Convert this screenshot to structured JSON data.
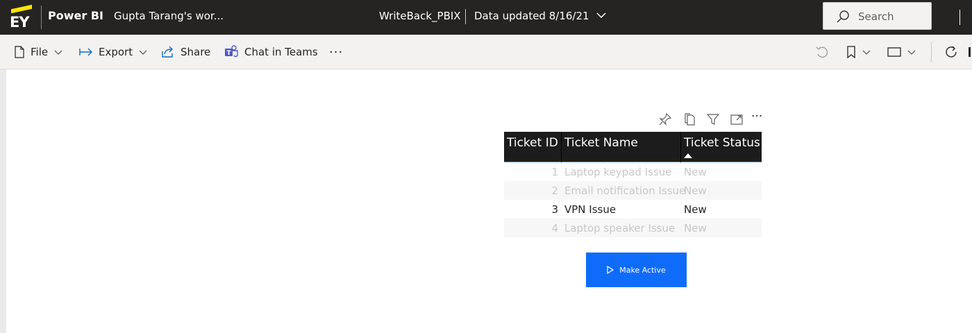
{
  "header": {
    "logo_text": "EY",
    "brand": "Power BI",
    "workspace": "Gupta Tarang's wor...",
    "report_title": "WriteBack_PBIX",
    "data_updated": "Data updated 8/16/21",
    "search_placeholder": "Search"
  },
  "actionbar": {
    "file": "File",
    "export": "Export",
    "share": "Share",
    "chat_in_teams": "Chat in Teams",
    "more": "···"
  },
  "table": {
    "columns": [
      "Ticket ID",
      "Ticket Name",
      "Ticket Status"
    ],
    "sort_column": "Ticket Status",
    "sort_direction": "ascending",
    "rows": [
      {
        "id": "1",
        "name": "Laptop keypad Issue",
        "status": "New",
        "selected": false
      },
      {
        "id": "2",
        "name": "Email notification Issue",
        "status": "New",
        "selected": false
      },
      {
        "id": "3",
        "name": "VPN Issue",
        "status": "New",
        "selected": true
      },
      {
        "id": "4",
        "name": "Laptop speaker Issue",
        "status": "New",
        "selected": false
      }
    ]
  },
  "button": {
    "label": "Make Active",
    "color": "#0f6cfb"
  },
  "colors": {
    "header_bg": "#252423",
    "actionbar_bg": "#f3f2f1",
    "table_header_bg": "#1c1c1c",
    "accent_yellow": "#ffe600"
  }
}
